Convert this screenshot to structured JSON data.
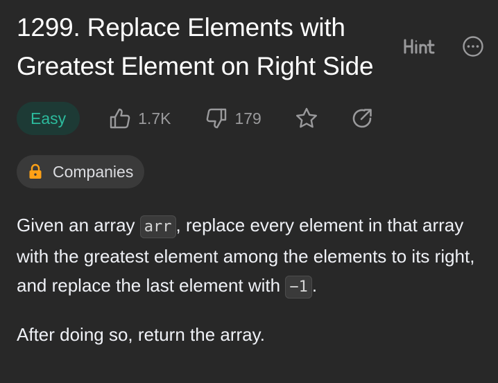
{
  "problem": {
    "title": "1299. Replace Elements with Greatest Element on Right Side",
    "hint_label": "Hint",
    "difficulty": "Easy",
    "likes": "1.7K",
    "dislikes": "179",
    "companies_label": "Companies"
  },
  "description": {
    "p1_part1": "Given an array ",
    "p1_code1": "arr",
    "p1_part2": ", replace every element in that array with the greatest element among the elements to its right, and replace the last element with ",
    "p1_code2": "−1",
    "p1_part3": ".",
    "p2": "After doing so, return the array."
  },
  "colors": {
    "background": "#282828",
    "easy_text": "#2cbb9d",
    "easy_bg": "#1d3a35",
    "lock": "#ffa116",
    "muted": "#9a9a9c"
  },
  "icons": [
    "hint-icon",
    "more-options-icon",
    "thumbs-up-icon",
    "thumbs-down-icon",
    "star-icon",
    "share-icon",
    "lock-icon"
  ]
}
